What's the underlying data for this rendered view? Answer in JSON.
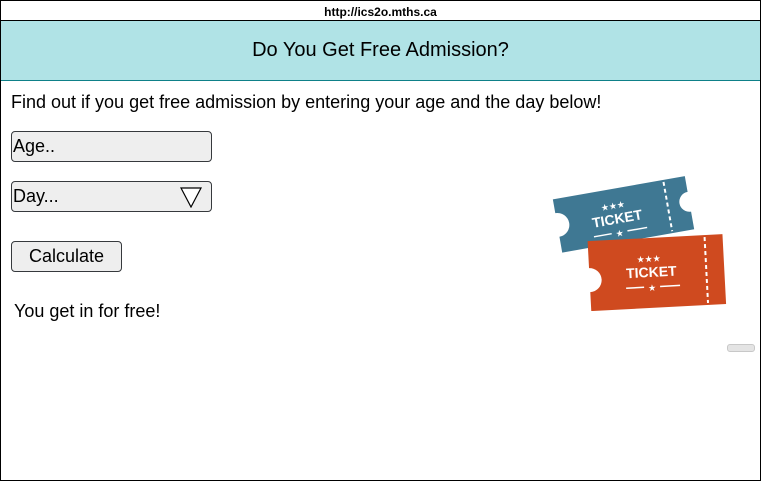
{
  "browser": {
    "url": "http://ics2o.mths.ca"
  },
  "header": {
    "title": "Do You Get Free Admission?",
    "background": "#b0e3e6"
  },
  "main": {
    "intro": "Find out if you get free admission by entering your age and the day below!",
    "age_input": {
      "placeholder": "Age.."
    },
    "day_select": {
      "placeholder": "Day...",
      "icon": "triangle-down-icon"
    },
    "calculate_label": "Calculate",
    "result": "You get in for free!"
  },
  "ticket_image": {
    "icon": "ticket-icon",
    "ticket_text": "TICKET",
    "colors": {
      "blue_ticket": "#3f7893",
      "orange_ticket": "#cf4a1f"
    }
  }
}
